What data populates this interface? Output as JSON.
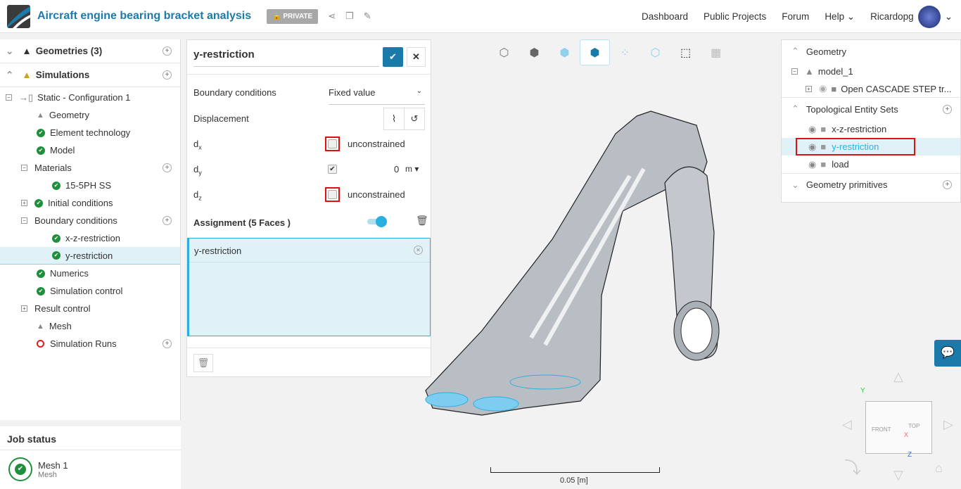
{
  "header": {
    "title": "Aircraft engine bearing bracket analysis",
    "privacy": "PRIVATE",
    "nav": [
      "Dashboard",
      "Public Projects",
      "Forum",
      "Help",
      "Ricardopg"
    ]
  },
  "tree": {
    "geometries": "Geometries (3)",
    "simulations": "Simulations",
    "items": [
      {
        "label": "Static - Configuration 1",
        "indent": 0,
        "icon": "box"
      },
      {
        "label": "Geometry",
        "indent": 1,
        "icon": "geometry"
      },
      {
        "label": "Element technology",
        "indent": 1,
        "icon": "check"
      },
      {
        "label": "Model",
        "indent": 1,
        "icon": "check"
      },
      {
        "label": "Materials",
        "indent": 1,
        "icon": "minus"
      },
      {
        "label": "15-5PH SS",
        "indent": 2,
        "icon": "check"
      },
      {
        "label": "Initial conditions",
        "indent": 1,
        "icon": "check-plus"
      },
      {
        "label": "Boundary conditions",
        "indent": 1,
        "icon": "minus"
      },
      {
        "label": "x-z-restriction",
        "indent": 2,
        "icon": "check"
      },
      {
        "label": "y-restriction",
        "indent": 2,
        "icon": "check",
        "selected": true
      },
      {
        "label": "Numerics",
        "indent": 1,
        "icon": "check"
      },
      {
        "label": "Simulation control",
        "indent": 1,
        "icon": "check"
      },
      {
        "label": "Result control",
        "indent": 1,
        "icon": "plus"
      },
      {
        "label": "Mesh",
        "indent": 1,
        "icon": "mesh"
      },
      {
        "label": "Simulation Runs",
        "indent": 1,
        "icon": "run"
      }
    ]
  },
  "job": {
    "title": "Job status",
    "name": "Mesh 1",
    "type": "Mesh"
  },
  "panel": {
    "name": "y-restriction",
    "bc_label": "Boundary conditions",
    "bc_value": "Fixed value",
    "displacement": "Displacement",
    "dx": "d",
    "dx_sub": "x",
    "dx_value": "unconstrained",
    "dy": "d",
    "dy_sub": "y",
    "dy_value": "0",
    "dy_unit": "m",
    "dz": "d",
    "dz_sub": "z",
    "dz_value": "unconstrained",
    "assignment": "Assignment (5 Faces )",
    "assigned": "y-restriction"
  },
  "right": {
    "geometry": "Geometry",
    "model": "model_1",
    "step": "Open CASCADE STEP tr...",
    "tes": "Topological Entity Sets",
    "sets": [
      "x-z-restriction",
      "y-restriction",
      "load"
    ],
    "primitives": "Geometry primitives"
  },
  "viewport": {
    "scale": "0.05 [m]",
    "cube_front": "FRONT",
    "cube_top": "TOP",
    "axis_y": "Y",
    "axis_z": "Z",
    "axis_x": "X"
  },
  "colors": {
    "accent": "#1a7bab",
    "select": "#2ab0e0",
    "ok": "#1f8f3c"
  }
}
